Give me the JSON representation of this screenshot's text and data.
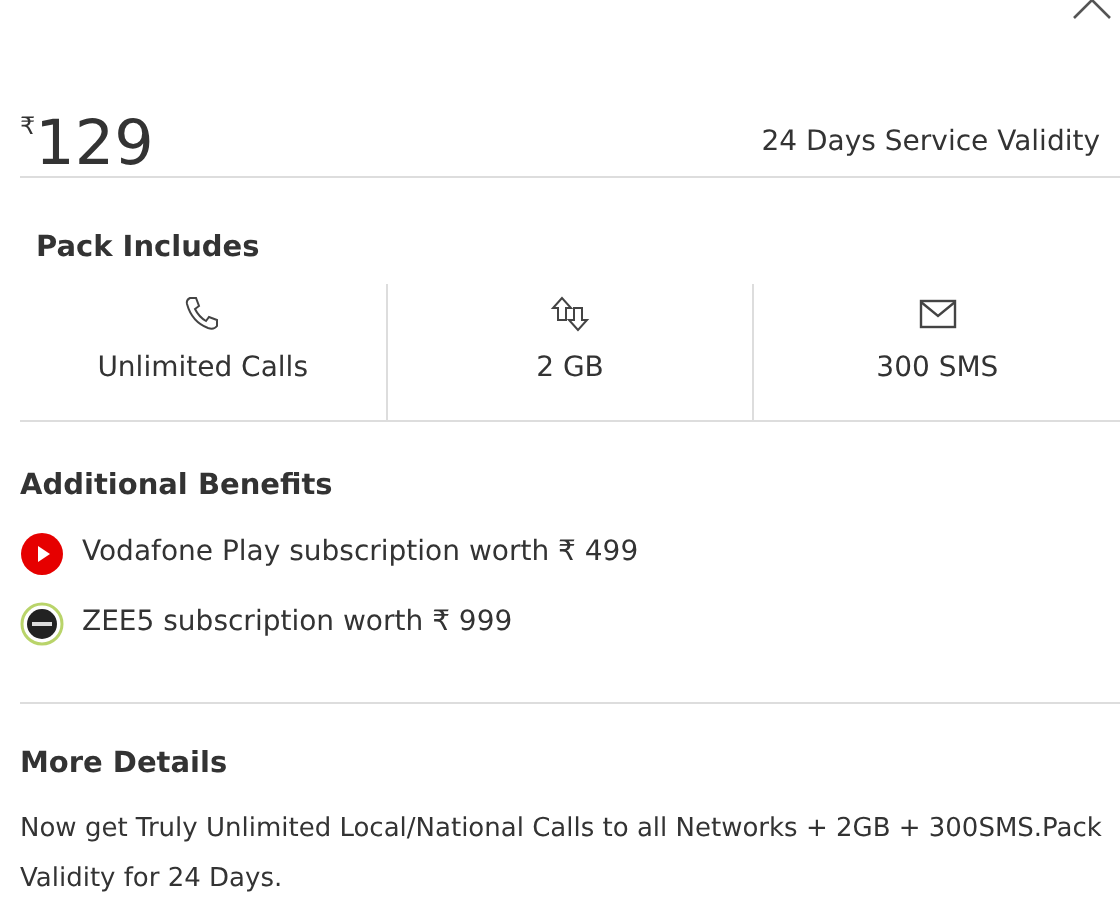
{
  "price": {
    "currency": "₹",
    "amount": "129"
  },
  "validity": "24 Days Service Validity",
  "pack": {
    "title": "Pack Includes",
    "items": [
      {
        "kind": "calls",
        "label": "Unlimited Calls"
      },
      {
        "kind": "data",
        "label": "2 GB"
      },
      {
        "kind": "sms",
        "label": "300 SMS"
      }
    ]
  },
  "benefits": {
    "title": "Additional Benefits",
    "items": [
      {
        "kind": "play",
        "label": "Vodafone Play subscription worth ₹ 499"
      },
      {
        "kind": "zee",
        "label": "ZEE5 subscription worth ₹ 999"
      }
    ]
  },
  "details": {
    "title": "More Details",
    "text": "Now get Truly Unlimited Local/National Calls to all Networks + 2GB + 300SMS.Pack Validity for 24 Days."
  }
}
